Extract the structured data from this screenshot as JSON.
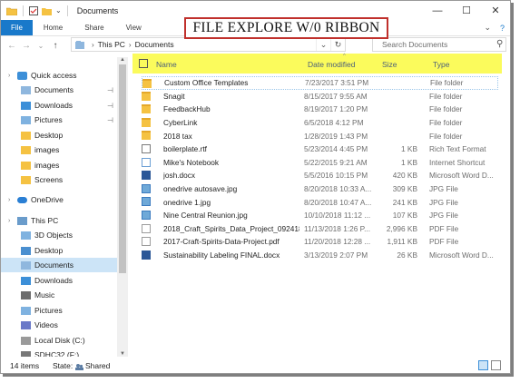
{
  "window": {
    "title": "Documents",
    "controls": {
      "minimize": "—",
      "maximize": "☐",
      "close": "✕"
    }
  },
  "overlay_banner": "FILE EXPLORE W/0 RIBBON",
  "ribbon": {
    "tabs": [
      "File",
      "Home",
      "Share",
      "View"
    ],
    "right": {
      "expand": "⌄",
      "help": "?"
    }
  },
  "navigation": {
    "back": "←",
    "forward": "→",
    "recent": "⌄",
    "up": "↑",
    "breadcrumb": [
      "This PC",
      "Documents"
    ],
    "dropdown": "⌄",
    "refresh": "↻"
  },
  "search": {
    "placeholder": "Search Documents"
  },
  "columns": {
    "name": "Name",
    "date": "Date modified",
    "size": "Size",
    "type": "Type"
  },
  "sidebar": [
    {
      "label": "Quick access",
      "icon": "star-icon",
      "pinned": false,
      "indent": 0
    },
    {
      "label": "Documents",
      "icon": "documents-icon",
      "pinned": true,
      "indent": 1
    },
    {
      "label": "Downloads",
      "icon": "download-icon",
      "pinned": true,
      "indent": 1
    },
    {
      "label": "Pictures",
      "icon": "pictures-icon",
      "pinned": true,
      "indent": 1
    },
    {
      "label": "Desktop",
      "icon": "folder-icon",
      "pinned": false,
      "indent": 1
    },
    {
      "label": "images",
      "icon": "folder-icon",
      "pinned": false,
      "indent": 1
    },
    {
      "label": "images",
      "icon": "folder-icon",
      "pinned": false,
      "indent": 1
    },
    {
      "label": "Screens",
      "icon": "folder-icon",
      "pinned": false,
      "indent": 1
    },
    {
      "label": "OneDrive",
      "icon": "onedrive-icon",
      "pinned": false,
      "indent": 0
    },
    {
      "label": "This PC",
      "icon": "pc-icon",
      "pinned": false,
      "indent": 0
    },
    {
      "label": "3D Objects",
      "icon": "3d-objects-icon",
      "pinned": false,
      "indent": 1
    },
    {
      "label": "Desktop",
      "icon": "desktop-icon",
      "pinned": false,
      "indent": 1
    },
    {
      "label": "Documents",
      "icon": "documents-icon",
      "pinned": false,
      "indent": 1,
      "selected": true
    },
    {
      "label": "Downloads",
      "icon": "download-icon",
      "pinned": false,
      "indent": 1
    },
    {
      "label": "Music",
      "icon": "music-icon",
      "pinned": false,
      "indent": 1
    },
    {
      "label": "Pictures",
      "icon": "pictures-icon",
      "pinned": false,
      "indent": 1
    },
    {
      "label": "Videos",
      "icon": "videos-icon",
      "pinned": false,
      "indent": 1
    },
    {
      "label": "Local Disk (C:)",
      "icon": "disk-icon",
      "pinned": false,
      "indent": 1
    },
    {
      "label": "SDHC32 (F:)",
      "icon": "sd-card-icon",
      "pinned": false,
      "indent": 1
    }
  ],
  "files": [
    {
      "name": "Custom Office Templates",
      "date": "7/23/2017 3:51 PM",
      "size": "",
      "type": "File folder",
      "icon": "folder"
    },
    {
      "name": "Snagit",
      "date": "8/15/2017 9:55 AM",
      "size": "",
      "type": "File folder",
      "icon": "folder"
    },
    {
      "name": "FeedbackHub",
      "date": "8/19/2017 1:20 PM",
      "size": "",
      "type": "File folder",
      "icon": "folder"
    },
    {
      "name": "CyberLink",
      "date": "6/5/2018 4:12 PM",
      "size": "",
      "type": "File folder",
      "icon": "folder"
    },
    {
      "name": "2018 tax",
      "date": "1/28/2019 1:43 PM",
      "size": "",
      "type": "File folder",
      "icon": "folder"
    },
    {
      "name": "boilerplate.rtf",
      "date": "5/23/2014 4:45 PM",
      "size": "1 KB",
      "type": "Rich Text Format",
      "icon": "doc"
    },
    {
      "name": "Mike's Notebook",
      "date": "5/22/2015 9:21 AM",
      "size": "1 KB",
      "type": "Internet Shortcut",
      "icon": "link"
    },
    {
      "name": "josh.docx",
      "date": "5/5/2016 10:15 PM",
      "size": "420 KB",
      "type": "Microsoft Word D...",
      "icon": "word"
    },
    {
      "name": "onedrive autosave.jpg",
      "date": "8/20/2018 10:33 A...",
      "size": "309 KB",
      "type": "JPG File",
      "icon": "img"
    },
    {
      "name": "onedrive 1.jpg",
      "date": "8/20/2018 10:47 A...",
      "size": "241 KB",
      "type": "JPG File",
      "icon": "img"
    },
    {
      "name": "Nine Central Reunion.jpg",
      "date": "10/10/2018 11:12 ...",
      "size": "107 KB",
      "type": "JPG File",
      "icon": "img"
    },
    {
      "name": "2018_Craft_Spirits_Data_Project_092418...",
      "date": "11/13/2018 1:26 P...",
      "size": "2,996 KB",
      "type": "PDF File",
      "icon": "pdf"
    },
    {
      "name": "2017-Craft-Spirits-Data-Project.pdf",
      "date": "11/20/2018 12:28 ...",
      "size": "1,911 KB",
      "type": "PDF File",
      "icon": "pdf"
    },
    {
      "name": "Sustainability Labeling FINAL.docx",
      "date": "3/13/2019 2:07 PM",
      "size": "26 KB",
      "type": "Microsoft Word D...",
      "icon": "word"
    }
  ],
  "status": {
    "count": "14 items",
    "state_label": "State:",
    "state_value": "Shared"
  }
}
